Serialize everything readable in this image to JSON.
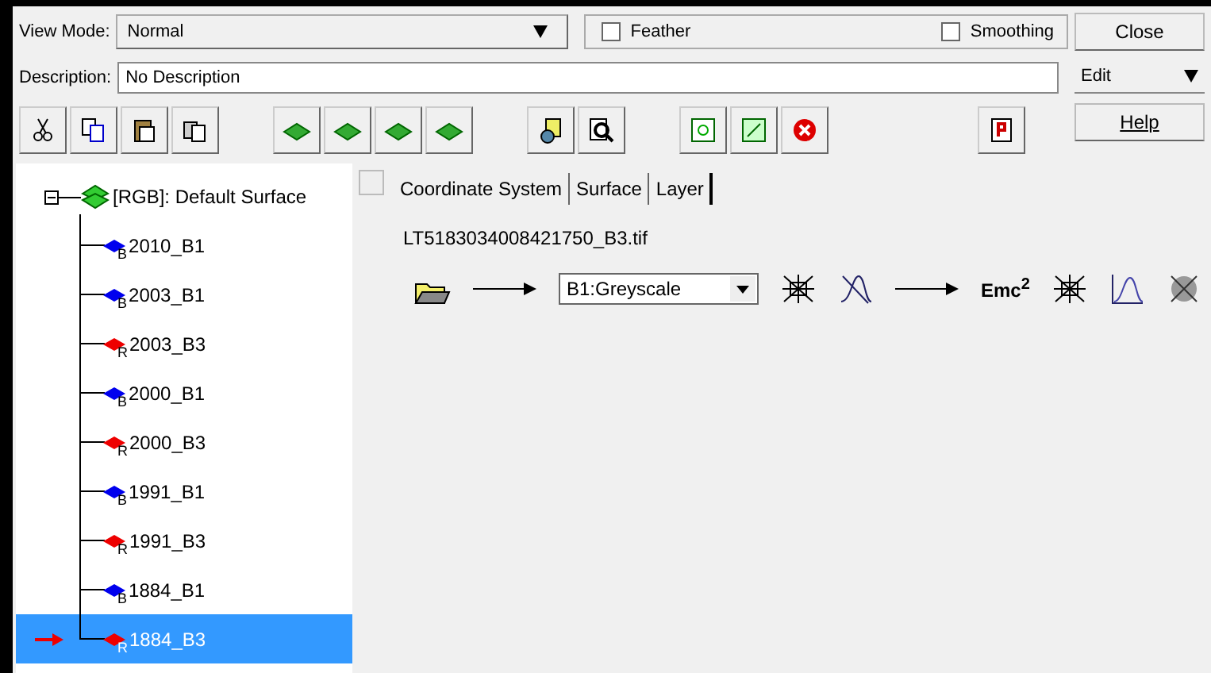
{
  "view_mode": {
    "label": "View Mode:",
    "value": "Normal"
  },
  "options": [
    {
      "label": "Feather",
      "checked": false
    },
    {
      "label": "Smoothing",
      "checked": false
    }
  ],
  "description": {
    "label": "Description:",
    "value": "No Description"
  },
  "side_buttons": {
    "close": "Close",
    "edit": "Edit",
    "help": "Help"
  },
  "tree": {
    "label": "[RGB]: Default Surface",
    "expanded": true,
    "children": [
      {
        "label": "2010_B1",
        "band": "B",
        "color": "#0000ee",
        "selected": false
      },
      {
        "label": "2003_B1",
        "band": "B",
        "color": "#0000ee",
        "selected": false
      },
      {
        "label": "2003_B3",
        "band": "R",
        "color": "#ee0000",
        "selected": false
      },
      {
        "label": "2000_B1",
        "band": "B",
        "color": "#0000ee",
        "selected": false
      },
      {
        "label": "2000_B3",
        "band": "R",
        "color": "#ee0000",
        "selected": false
      },
      {
        "label": "1991_B1",
        "band": "B",
        "color": "#0000ee",
        "selected": false
      },
      {
        "label": "1991_B3",
        "band": "R",
        "color": "#ee0000",
        "selected": false
      },
      {
        "label": "1884_B1",
        "band": "B",
        "color": "#0000ee",
        "selected": false
      },
      {
        "label": "1884_B3",
        "band": "R",
        "color": "#ee0000",
        "selected": true
      }
    ]
  },
  "tabs": [
    {
      "label": "Coordinate System",
      "selected": false
    },
    {
      "label": "Surface",
      "selected": false
    },
    {
      "label": "Layer",
      "selected": true
    }
  ],
  "layer": {
    "filename": "LT5183034008421750_B3.tif",
    "colormap": "B1:Greyscale",
    "formula": "Emc$^{2}$"
  }
}
